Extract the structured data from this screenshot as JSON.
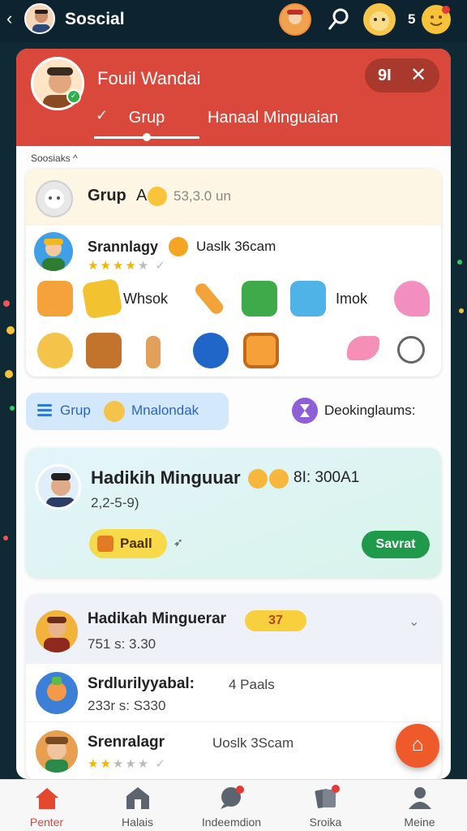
{
  "topbar": {
    "back": "‹",
    "title": "Soscial",
    "count": "5"
  },
  "header": {
    "name": "Fouil Wandai",
    "pill_text": "9I",
    "close": "✕",
    "tab_active": "Grup",
    "tab_other": "Hanaal Minguaian"
  },
  "section_label": "Soosiaks ^",
  "group": {
    "title": "Grup",
    "num": "A",
    "meta": "53,3.0 un",
    "member": {
      "name": "Srannlagy",
      "meta": "Uaslk 36cam",
      "rating": 4
    },
    "item_text_1": "Whsok",
    "item_text_2": "Imok"
  },
  "chip": {
    "label": "Grup",
    "label2": "Mnalondak"
  },
  "decking_label": "Deokinglaums:",
  "featured": {
    "title": "Hadikih Minguuar",
    "meta": "8I: 300A1",
    "sub": "2,2-5-9)",
    "paid_label": "Paall",
    "save_label": "Savrat"
  },
  "ranking": {
    "head_title": "Hadikah Minguerar",
    "head_badge": "37",
    "head_sub": "751 s: 3.30",
    "row2_title": "Srdlurilyyabal:",
    "row2_meta": "4 Paals",
    "row2_sub": "233r s: S330",
    "row3_title": "Srenralagr",
    "row3_meta": "Uoslk 3Scam",
    "row3_rating": 2
  },
  "nav": [
    {
      "label": "Penter",
      "icon": "home-icon"
    },
    {
      "label": "Halais",
      "icon": "building-icon"
    },
    {
      "label": "Indeemdion",
      "icon": "chat-icon"
    },
    {
      "label": "Sroika",
      "icon": "cards-icon"
    },
    {
      "label": "Meine",
      "icon": "profile-icon"
    }
  ],
  "colors": {
    "header_red": "#d9483a",
    "save_green": "#1f9a4a",
    "accent_orange": "#ee5a2a"
  }
}
